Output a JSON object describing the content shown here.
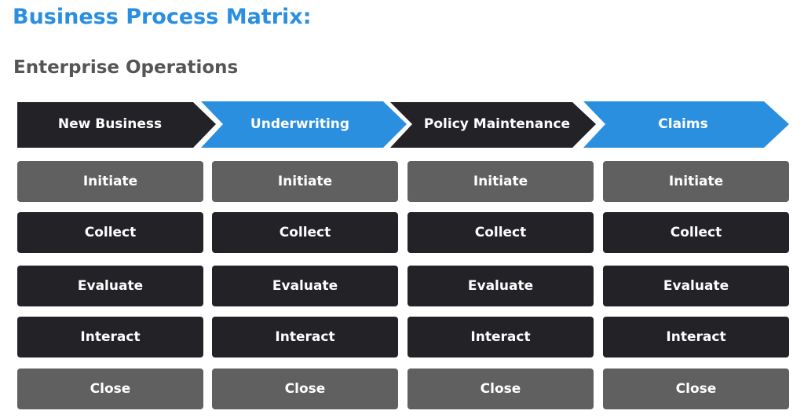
{
  "header": {
    "title": "Business Process Matrix:",
    "subtitle": "Enterprise Operations"
  },
  "colors": {
    "accent_blue": "#2b8fe0",
    "dark": "#232227",
    "gray": "#606060",
    "subtitle_gray": "#555555"
  },
  "stages": [
    {
      "label": "New Business",
      "color": "dark"
    },
    {
      "label": "Underwriting",
      "color": "blue"
    },
    {
      "label": "Policy Maintenance",
      "color": "dark"
    },
    {
      "label": "Claims",
      "color": "blue"
    }
  ],
  "steps": [
    {
      "label": "Initiate",
      "style": "gray"
    },
    {
      "label": "Collect",
      "style": "dark"
    },
    {
      "label": "Evaluate",
      "style": "dark"
    },
    {
      "label": "Interact",
      "style": "dark"
    },
    {
      "label": "Close",
      "style": "gray"
    }
  ],
  "matrix": [
    [
      "Initiate",
      "Initiate",
      "Initiate",
      "Initiate"
    ],
    [
      "Collect",
      "Collect",
      "Collect",
      "Collect"
    ],
    [
      "Evaluate",
      "Evaluate",
      "Evaluate",
      "Evaluate"
    ],
    [
      "Interact",
      "Interact",
      "Interact",
      "Interact"
    ],
    [
      "Close",
      "Close",
      "Close",
      "Close"
    ]
  ]
}
